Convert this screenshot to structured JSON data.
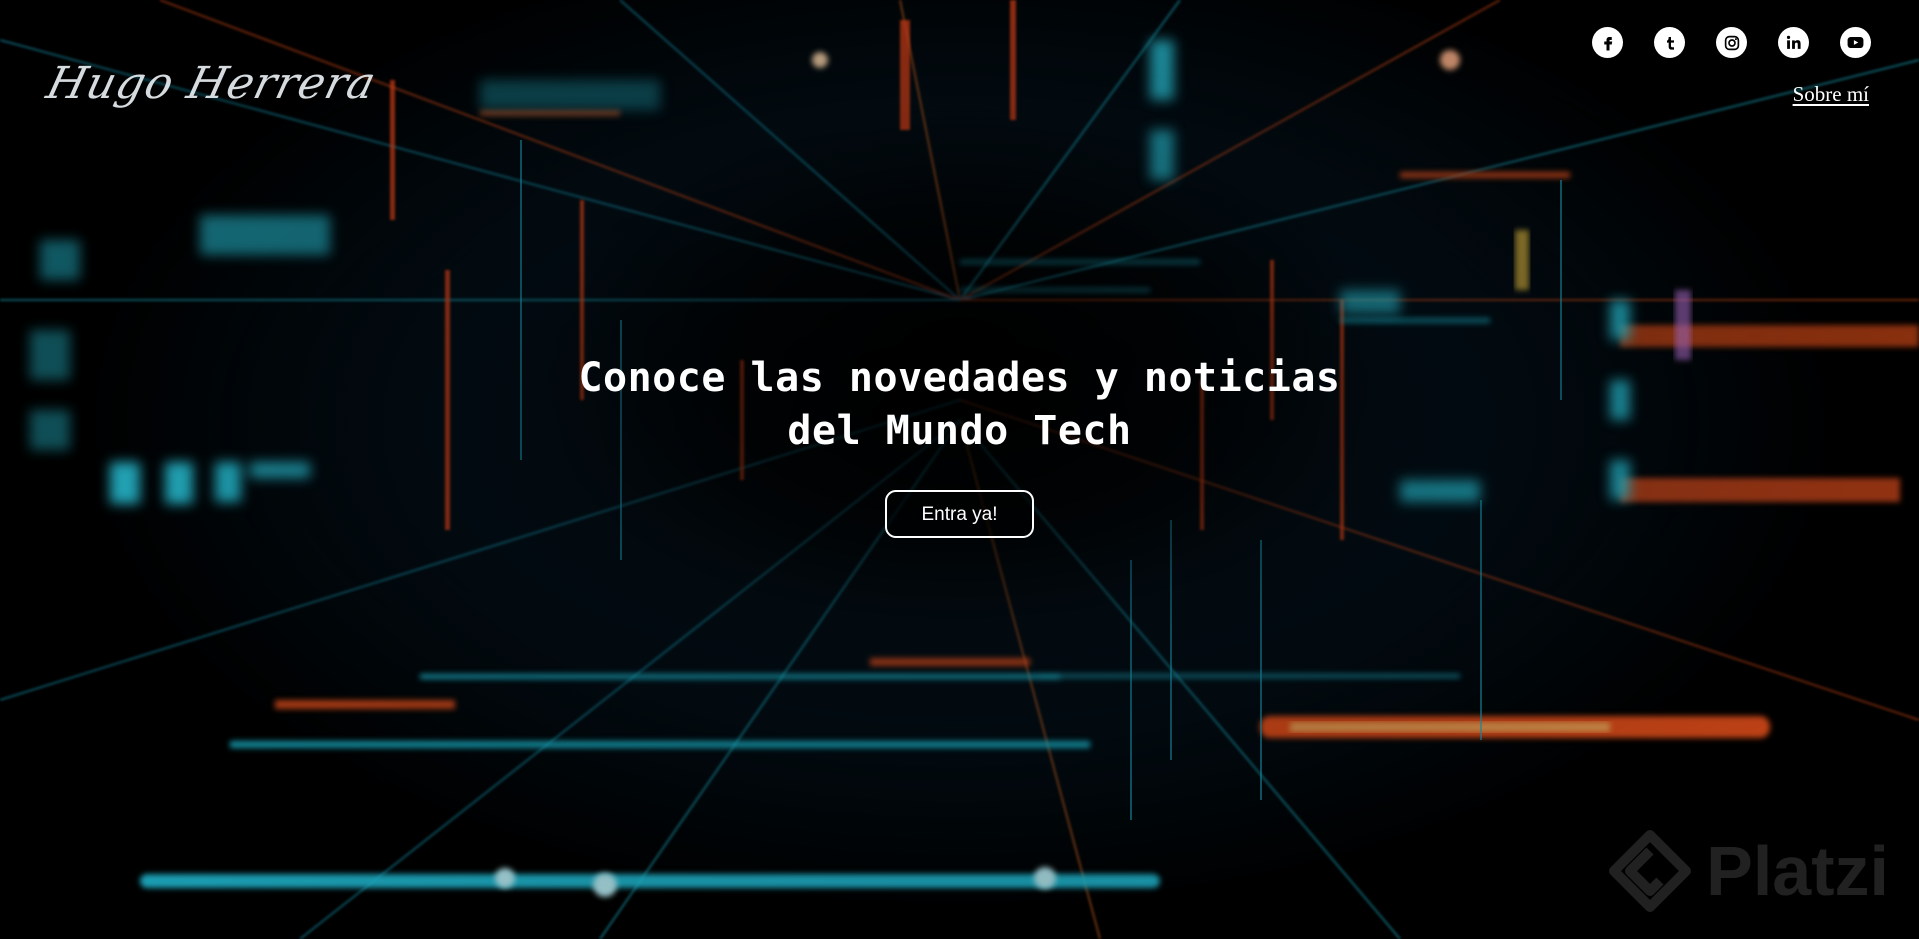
{
  "header": {
    "logo_text": "Hugo Herrera",
    "about_link": "Sobre mí",
    "social": [
      {
        "name": "facebook",
        "icon": "facebook-icon"
      },
      {
        "name": "tumblr",
        "icon": "tumblr-icon"
      },
      {
        "name": "instagram",
        "icon": "instagram-icon"
      },
      {
        "name": "linkedin",
        "icon": "linkedin-icon"
      },
      {
        "name": "youtube",
        "icon": "youtube-icon"
      }
    ]
  },
  "hero": {
    "title_line1": "Conoce las novedades y noticias",
    "title_line2": "del Mundo Tech",
    "cta_label": "Entra ya!"
  },
  "watermark": {
    "text": "Platzi"
  },
  "colors": {
    "text": "#ffffff",
    "background": "#000000",
    "accent_cyan": "#22d3ee",
    "accent_orange": "#ff5a1f"
  }
}
